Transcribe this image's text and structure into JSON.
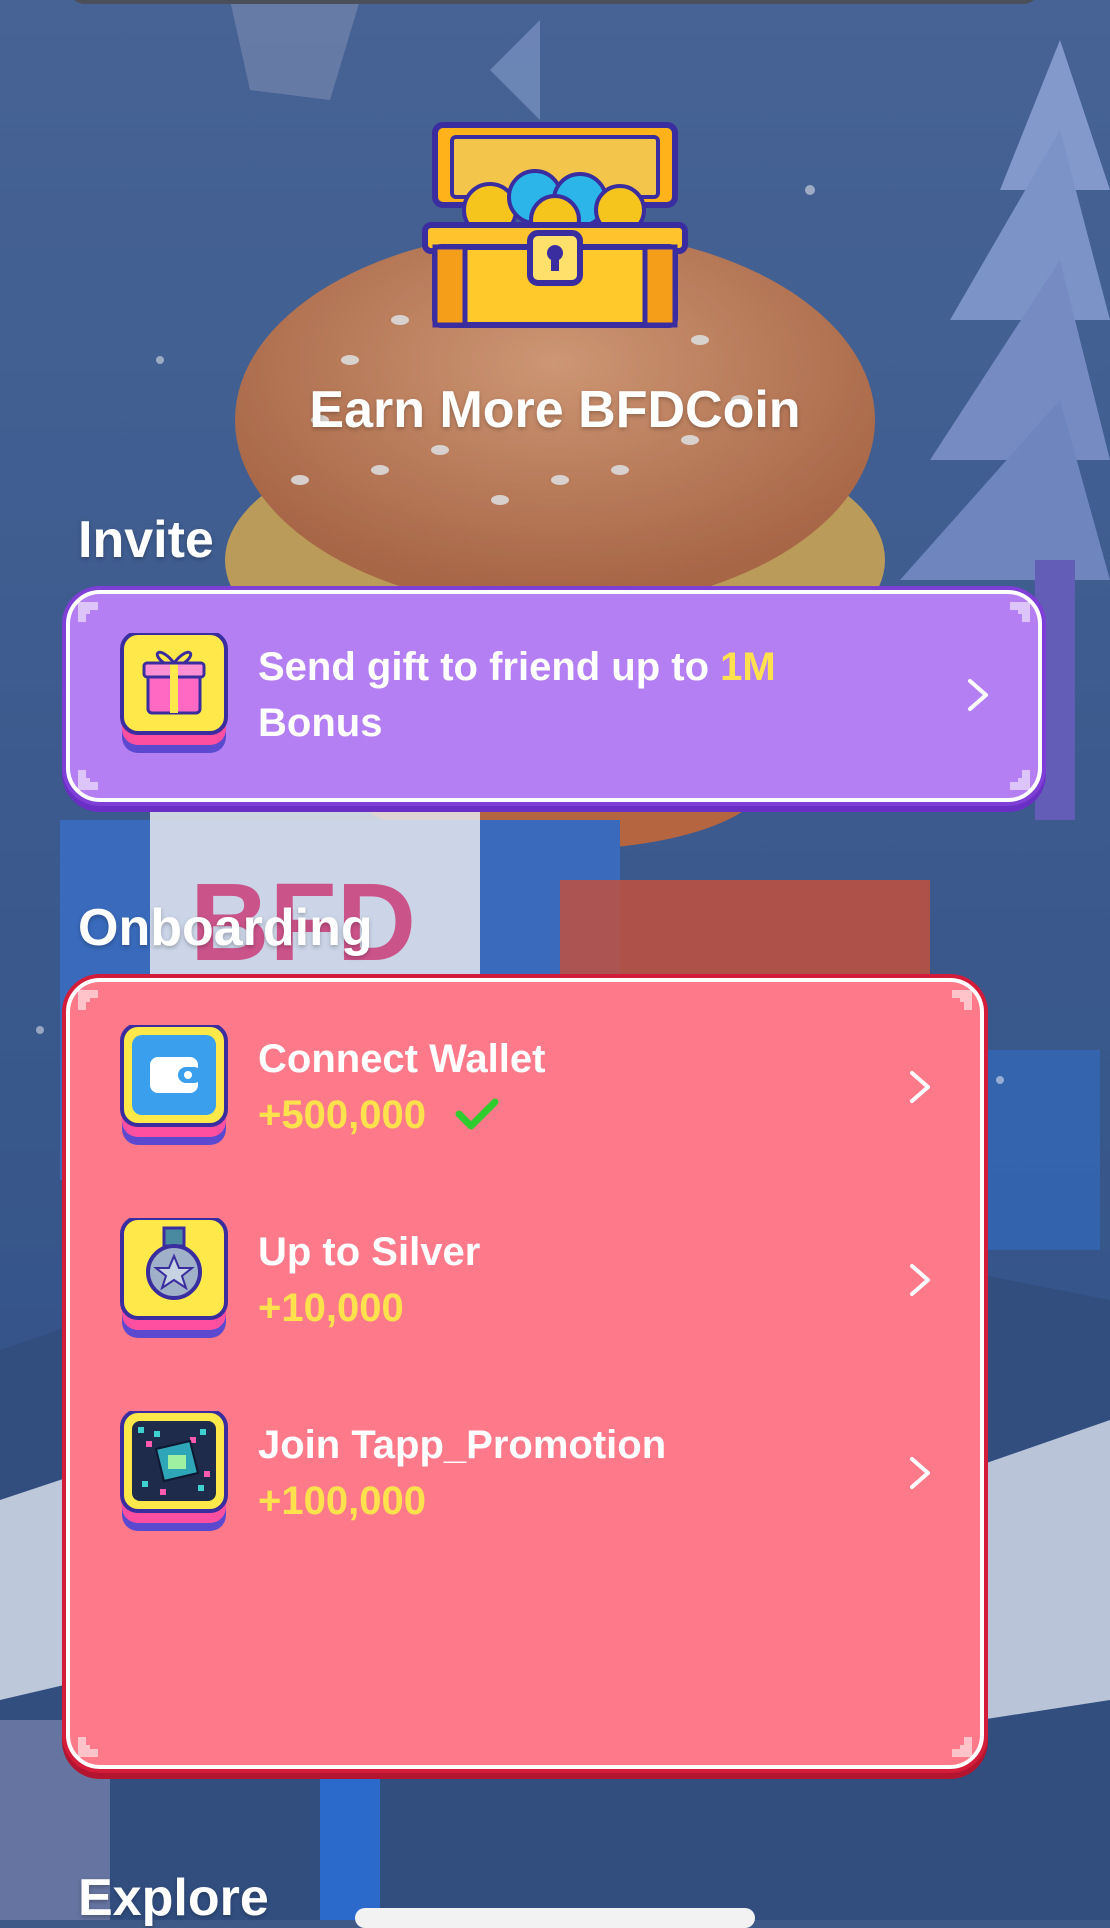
{
  "header": {
    "title": "Earn More BFDCoin"
  },
  "invite": {
    "section_label": "Invite",
    "card": {
      "text_prefix": "Send gift to friend up to ",
      "highlight": "1M",
      "text_suffix": "Bonus",
      "icon": "gift-icon"
    }
  },
  "onboarding": {
    "section_label": "Onboarding",
    "items": [
      {
        "title": "Connect Wallet",
        "reward": "+500,000",
        "completed": true,
        "icon": "wallet-icon"
      },
      {
        "title": "Up to Silver",
        "reward": "+10,000",
        "completed": false,
        "icon": "silver-medal-icon"
      },
      {
        "title": "Join Tapp_Promotion",
        "reward": "+100,000",
        "completed": false,
        "icon": "promotion-phone-icon"
      }
    ]
  },
  "explore": {
    "section_label": "Explore"
  },
  "colors": {
    "invite_card": "#b47ff3",
    "onboarding_card": "#fe7a8a",
    "reward_yellow": "#ffe14d",
    "check_green": "#2ecc2e"
  }
}
